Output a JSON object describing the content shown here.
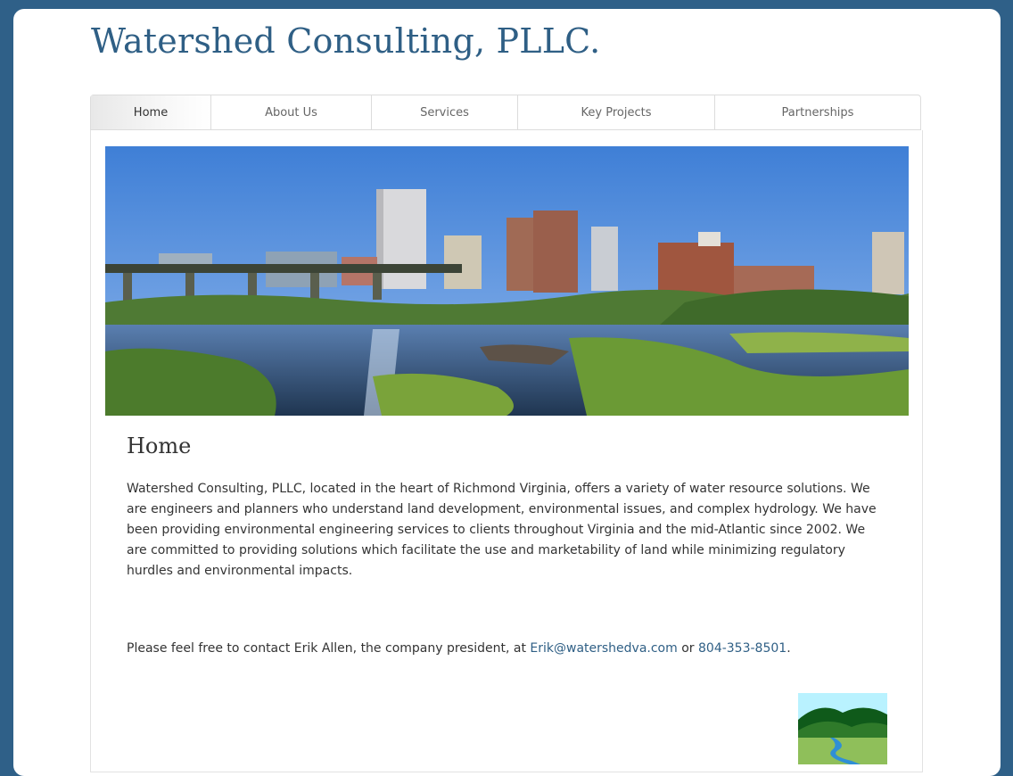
{
  "site": {
    "title": "Watershed Consulting, PLLC."
  },
  "nav": {
    "items": [
      {
        "label": "Home",
        "active": true
      },
      {
        "label": "About Us"
      },
      {
        "label": "Services"
      },
      {
        "label": "Key Projects"
      },
      {
        "label": "Partnerships"
      }
    ]
  },
  "main": {
    "heading": "Home",
    "intro": "Watershed Consulting, PLLC, located in the heart of Richmond Virginia, offers a variety of water resource solutions. We are engineers and planners who understand land development, environmental issues, and complex hydrology. We have been providing environmental engineering services to clients throughout Virginia and the mid-Atlantic since 2002. We are committed to providing solutions which facilitate the use and marketability of land while minimizing regulatory hurdles and environmental impacts.",
    "contact_prefix": "Please feel free to contact Erik Allen, the company president, at ",
    "email": "Erik@watershedva.com",
    "contact_or": " or ",
    "phone": "804-353-8501",
    "contact_suffix": "."
  },
  "colors": {
    "background": "#2f6088",
    "title": "#2f5f85",
    "link": "#2f5f85"
  },
  "icons": {
    "hero": "richmond-skyline-river-photo",
    "logo": "watershed-hills-river-logo"
  }
}
